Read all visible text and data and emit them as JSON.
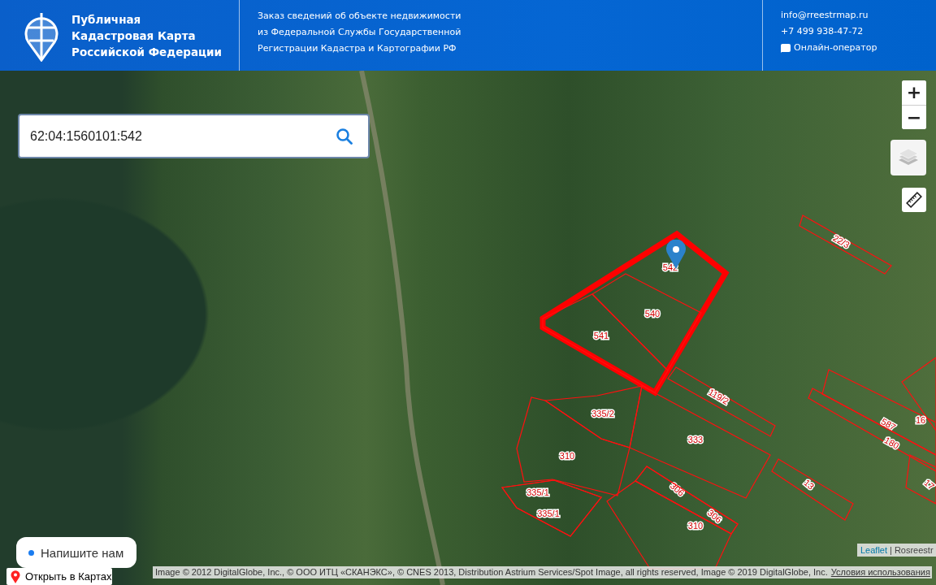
{
  "header": {
    "title_lines": [
      "Публичная",
      "Кадастровая Карта",
      "Российской Федерации"
    ],
    "description_lines": [
      "Заказ сведений об объекте недвижимости",
      "из Федеральной Службы Государственной",
      "Регистрации Кадастра и Картографии РФ"
    ],
    "email": "info@rreestrmap.ru",
    "phone": "+7 499 938-47-72",
    "operator": "Онлайн-оператор"
  },
  "search": {
    "value": "62:04:1560101:542"
  },
  "zoom_controls": {
    "zoom_in": "+",
    "zoom_out": "−"
  },
  "parcels": [
    {
      "label": "542",
      "selected": true
    },
    {
      "label": "540",
      "selected": false
    },
    {
      "label": "541",
      "selected": false
    },
    {
      "label": "22/3",
      "selected": false
    },
    {
      "label": "119/2",
      "selected": false
    },
    {
      "label": "335/2",
      "selected": false
    },
    {
      "label": "333",
      "selected": false
    },
    {
      "label": "310",
      "selected": false
    },
    {
      "label": "335/1",
      "selected": false
    },
    {
      "label": "335/1",
      "selected": false
    },
    {
      "label": "306",
      "selected": false
    },
    {
      "label": "306",
      "selected": false
    },
    {
      "label": "310",
      "selected": false
    },
    {
      "label": "13",
      "selected": false
    },
    {
      "label": "587",
      "selected": false
    },
    {
      "label": "180",
      "selected": false
    },
    {
      "label": "16",
      "selected": false
    },
    {
      "label": "17",
      "selected": false
    }
  ],
  "chat_button": "Напишите нам",
  "open_in_maps": "Открыть в Картах",
  "attribution": {
    "text": "Image © 2012 DigitalGlobe, Inc., © ООО ИТЦ «СКАНЭКС», © CNES 2013, Distribution Astrium Services/Spot Image, all rights reserved, Image © 2019 DigitalGlobe, Inc.",
    "terms_link": "Условия использования"
  },
  "leaflet_attribution": {
    "leaflet": "Leaflet",
    "separator": "|",
    "source": "Rosreestr"
  }
}
